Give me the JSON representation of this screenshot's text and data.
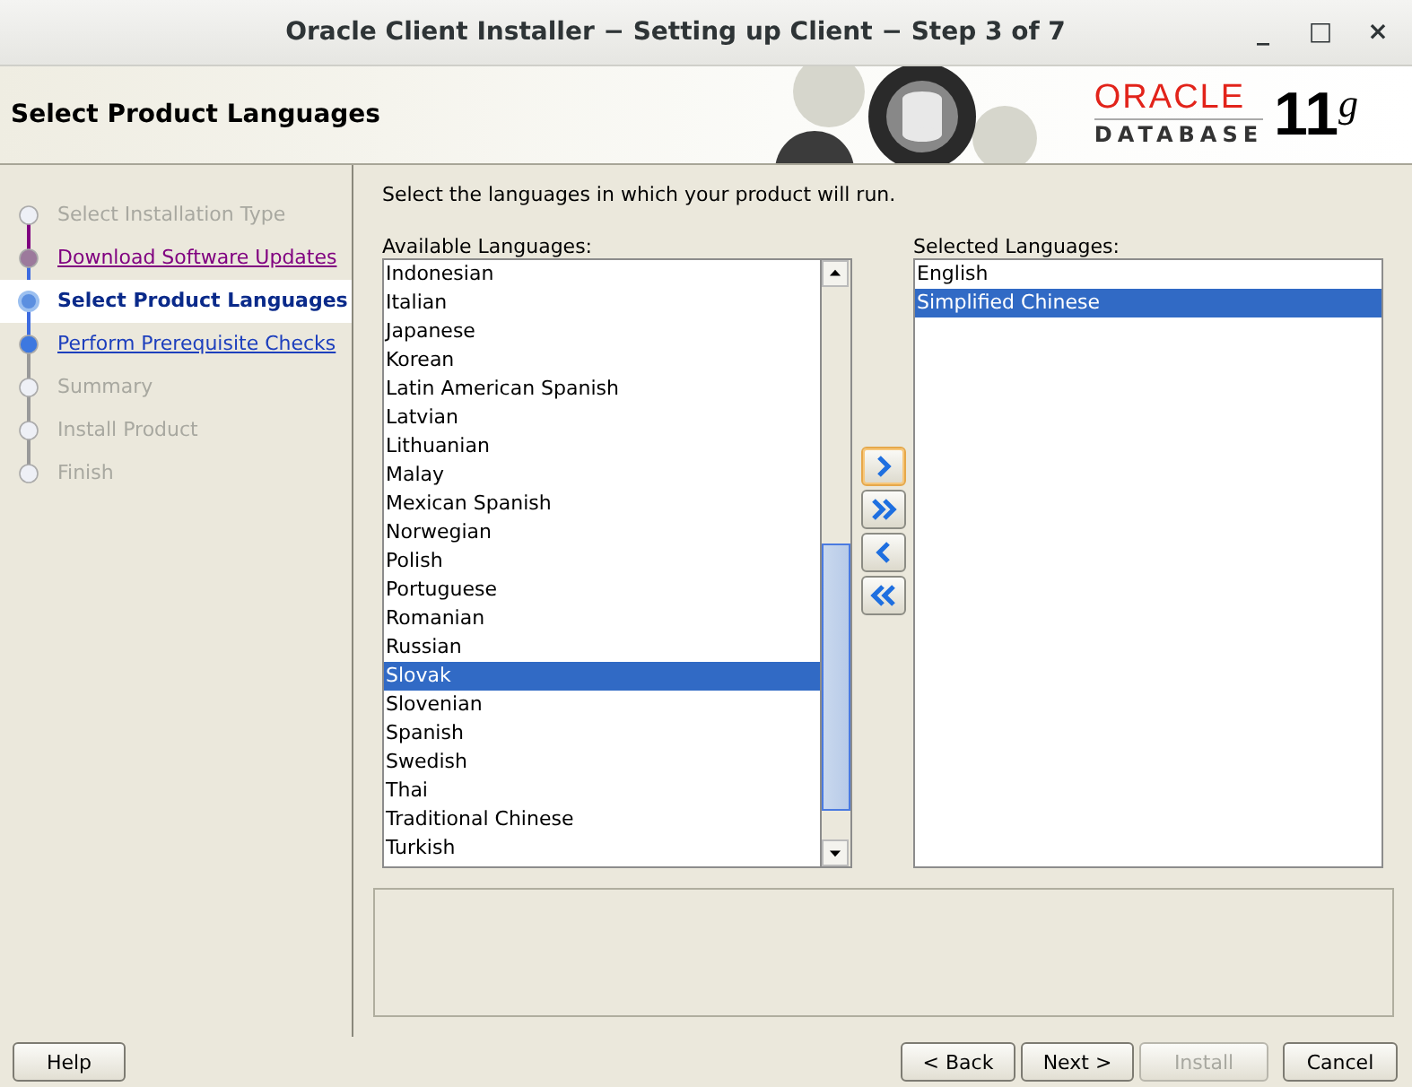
{
  "window": {
    "title": "Oracle Client Installer − Setting up Client − Step 3 of 7",
    "controls": [
      "_",
      "□",
      "×"
    ]
  },
  "header": {
    "title": "Select Product Languages",
    "brand": "ORACLE",
    "product": "DATABASE",
    "version": "11",
    "version_suffix": "g"
  },
  "steps": [
    {
      "label": "Select Installation Type",
      "kind": "disabled"
    },
    {
      "label": "Download Software Updates",
      "kind": "visited"
    },
    {
      "label": "Select Product Languages",
      "kind": "current"
    },
    {
      "label": "Perform Prerequisite Checks",
      "kind": "link"
    },
    {
      "label": "Summary",
      "kind": "disabled"
    },
    {
      "label": "Install Product",
      "kind": "disabled"
    },
    {
      "label": "Finish",
      "kind": "disabled"
    }
  ],
  "instruction": "Select the languages in which your product will run.",
  "available": {
    "label": "Available Languages:",
    "items": [
      {
        "label": "Indonesian",
        "selected": false
      },
      {
        "label": "Italian",
        "selected": false
      },
      {
        "label": "Japanese",
        "selected": false
      },
      {
        "label": "Korean",
        "selected": false
      },
      {
        "label": "Latin American Spanish",
        "selected": false
      },
      {
        "label": "Latvian",
        "selected": false
      },
      {
        "label": "Lithuanian",
        "selected": false
      },
      {
        "label": "Malay",
        "selected": false
      },
      {
        "label": "Mexican Spanish",
        "selected": false
      },
      {
        "label": "Norwegian",
        "selected": false
      },
      {
        "label": "Polish",
        "selected": false
      },
      {
        "label": "Portuguese",
        "selected": false
      },
      {
        "label": "Romanian",
        "selected": false
      },
      {
        "label": "Russian",
        "selected": false
      },
      {
        "label": "Slovak",
        "selected": true
      },
      {
        "label": "Slovenian",
        "selected": false
      },
      {
        "label": "Spanish",
        "selected": false
      },
      {
        "label": "Swedish",
        "selected": false
      },
      {
        "label": "Thai",
        "selected": false
      },
      {
        "label": "Traditional Chinese",
        "selected": false
      },
      {
        "label": "Turkish",
        "selected": false
      }
    ]
  },
  "move_buttons": [
    {
      "kind": "add",
      "focused": true
    },
    {
      "kind": "add-all",
      "focused": false
    },
    {
      "kind": "remove",
      "focused": false
    },
    {
      "kind": "remove-all",
      "focused": false
    }
  ],
  "selected": {
    "label": "Selected Languages:",
    "items": [
      {
        "label": "English",
        "selected": false
      },
      {
        "label": "Simplified Chinese",
        "selected": true
      }
    ]
  },
  "buttons": [
    {
      "label": "Help",
      "disabled": false
    },
    {
      "label": "< Back",
      "disabled": false
    },
    {
      "label": "Next >",
      "disabled": false
    },
    {
      "label": "Install",
      "disabled": true
    },
    {
      "label": "Cancel",
      "disabled": false
    }
  ]
}
